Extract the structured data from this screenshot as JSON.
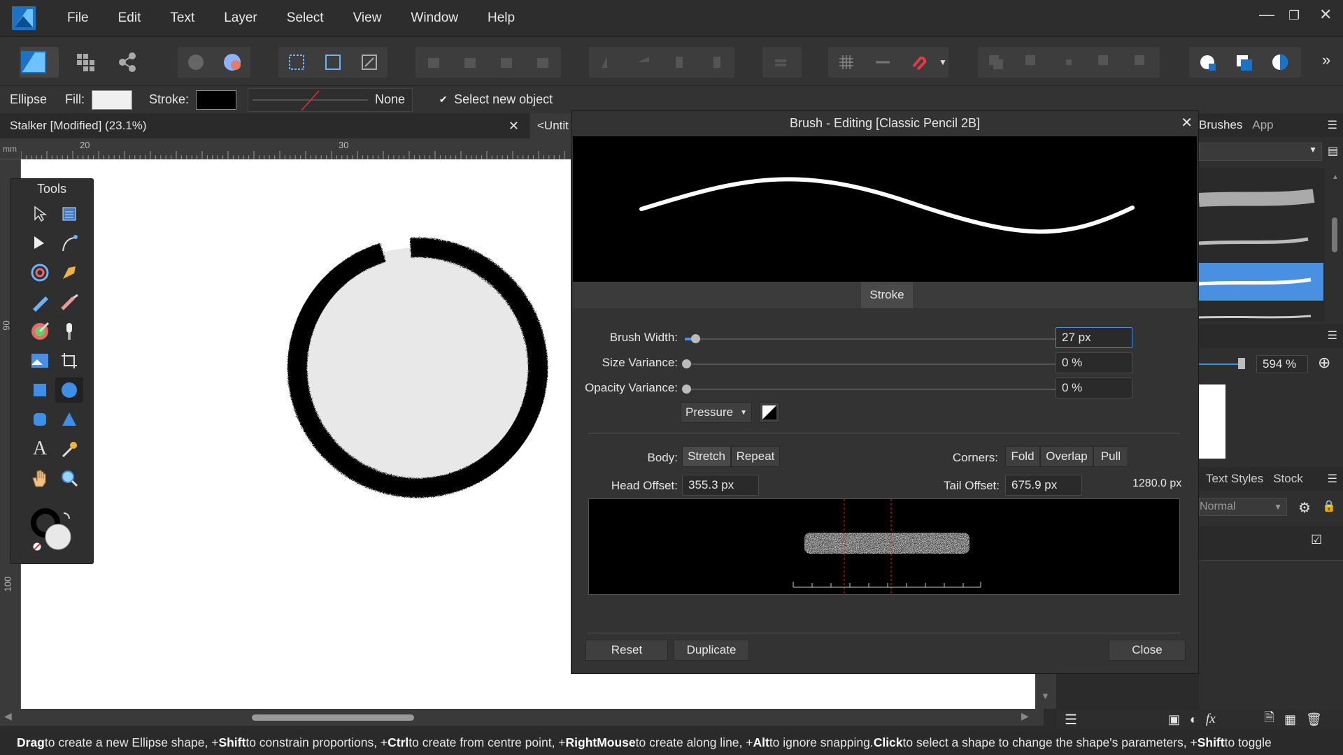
{
  "menu": [
    "File",
    "Edit",
    "Text",
    "Layer",
    "Select",
    "View",
    "Window",
    "Help"
  ],
  "context": {
    "tool": "Ellipse",
    "fill_label": "Fill:",
    "stroke_label": "Stroke:",
    "stroke_style": "None",
    "select_new_object": "Select new object",
    "fill_color": "#f0f0f0",
    "stroke_color": "#000000"
  },
  "document_tab": {
    "title": "Stalker [Modified] (23.1%)",
    "second_tab": "<Untit"
  },
  "ruler": {
    "unit": "mm",
    "h_ticks": [
      "20",
      "30"
    ],
    "v_ticks": [
      "90",
      "100"
    ]
  },
  "tools_panel": {
    "title": "Tools"
  },
  "dialog": {
    "title": "Brush - Editing [Classic Pencil 2B]",
    "section": "Stroke",
    "brush_width_label": "Brush Width:",
    "brush_width": "27 px",
    "brush_width_level": 0.02,
    "size_variance_label": "Size Variance:",
    "size_variance": "0 %",
    "opacity_variance_label": "Opacity Variance:",
    "opacity_variance": "0 %",
    "pressure": "Pressure",
    "body_label": "Body:",
    "body_stretch": "Stretch",
    "body_repeat": "Repeat",
    "corners_label": "Corners:",
    "corners_fold": "Fold",
    "corners_overlap": "Overlap",
    "corners_pull": "Pull",
    "head_offset_label": "Head Offset:",
    "head_offset": "355.3 px",
    "tail_offset_label": "Tail Offset:",
    "tail_offset": "675.9 px",
    "total_length": "1280.0 px",
    "reset": "Reset",
    "duplicate": "Duplicate",
    "close": "Close"
  },
  "right_panel": {
    "tab_brushes": "Brushes",
    "tab_app": "App",
    "zoom": "594 %",
    "tab_text_styles": "Text Styles",
    "tab_stock": "Stock",
    "blend_mode": "Normal",
    "accent": "#4a90e2"
  },
  "status": {
    "k1": "Drag",
    "t1": " to create a new Ellipse shape, +",
    "k2": "Shift",
    "t2": " to constrain proportions, +",
    "k3": "Ctrl",
    "t3": " to create from centre point, +",
    "k4": "RightMouse",
    "t4": " to create along line, +",
    "k5": "Alt",
    "t5": " to ignore snapping. ",
    "k6": "Click",
    "t6": " to select a shape to change the shape's parameters, +",
    "k7": "Shift",
    "t7": " to toggle"
  }
}
